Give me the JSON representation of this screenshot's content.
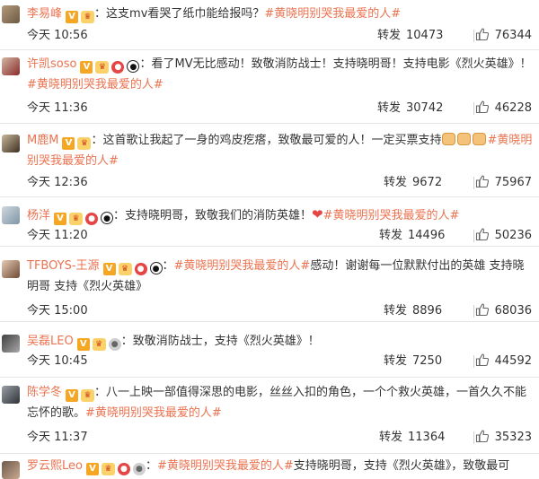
{
  "comments": [
    {
      "username": "李易峰",
      "badges": [
        "V",
        "crown"
      ],
      "sep": "：",
      "text_before": "这支mv看哭了纸巾能给报吗？",
      "topic": "#黄晓明别哭我最爱的人#",
      "text_after": "",
      "time": "今天 10:56",
      "repost_label": "转发",
      "repost_count": "10473",
      "like_count": "76344"
    },
    {
      "username": "许凯soso",
      "badges": [
        "V",
        "crown",
        "red",
        "panda"
      ],
      "sep": "：",
      "text_before": "看了MV无比感动！致敬消防战士！支持晓明哥！支持电影《烈火英雄》！",
      "topic": "#黄晓明别哭我最爱的人#",
      "text_after": "",
      "time": "今天 11:36",
      "repost_label": "转发",
      "repost_count": "30742",
      "like_count": "46228"
    },
    {
      "username": "M鹿M",
      "badges": [
        "V",
        "crown"
      ],
      "sep": "：",
      "text_before": "这首歌让我起了一身的鸡皮疙瘩，致敬最可爱的人！一定买票支持",
      "emojis": [
        "fist",
        "fist",
        "fist"
      ],
      "topic": "#黄晓明别哭我最爱的人#",
      "text_after": "",
      "time": "今天 12:36",
      "repost_label": "转发",
      "repost_count": "9672",
      "like_count": "75967"
    },
    {
      "username": "杨洋",
      "badges": [
        "V",
        "crown",
        "red",
        "panda"
      ],
      "sep": "：",
      "text_before": "支持晓明哥，致敬我们的消防英雄！",
      "heart": "❤",
      "topic": "#黄晓明别哭我最爱的人#",
      "text_after": "",
      "time": "今天 11:20",
      "repost_label": "转发",
      "repost_count": "14496",
      "like_count": "50236"
    },
    {
      "username": "TFBOYS-王源",
      "badges": [
        "V",
        "crown",
        "red",
        "panda"
      ],
      "sep": "：",
      "text_before": "",
      "topic": "#黄晓明别哭我最爱的人#",
      "text_after": "感动！谢谢每一位默默付出的英雄 支持晓明哥 支持《烈火英雄》",
      "time": "今天 15:00",
      "repost_label": "转发",
      "repost_count": "8896",
      "like_count": "68036"
    },
    {
      "username": "吴磊LEO",
      "badges": [
        "V",
        "crown",
        "grey"
      ],
      "sep": "：",
      "text_before": "致敬消防战士，支持《烈火英雄》！",
      "topic": "",
      "text_after": "",
      "time": "今天 10:45",
      "repost_label": "转发",
      "repost_count": "7250",
      "like_count": "44592"
    },
    {
      "username": "陈学冬",
      "badges": [
        "V",
        "crown"
      ],
      "sep": "：",
      "text_before": "八一上映一部值得深思的电影，丝丝入扣的角色，一个个救火英雄，一首久久不能忘怀的歌。",
      "topic": "#黄晓明别哭我最爱的人#",
      "text_after": "",
      "time": "今天 11:37",
      "repost_label": "转发",
      "repost_count": "11364",
      "like_count": "35323"
    },
    {
      "username": "罗云熙Leo",
      "badges": [
        "V",
        "crown",
        "red",
        "grey"
      ],
      "sep": "：",
      "text_before": "",
      "topic": "#黄晓明别哭我最爱的人#",
      "text_after": "支持晓明哥，支持《烈火英雄》，致敬最可",
      "time": "",
      "repost_label": "",
      "repost_count": "",
      "like_count": ""
    }
  ],
  "colors": {
    "username": "#eb7350",
    "topic": "#eb7350",
    "text": "#333333",
    "divider": "#e6e6e6"
  },
  "icons": {
    "like": "thumbs-up-icon",
    "vip": "v-badge-icon",
    "crown": "crown-badge-icon"
  }
}
